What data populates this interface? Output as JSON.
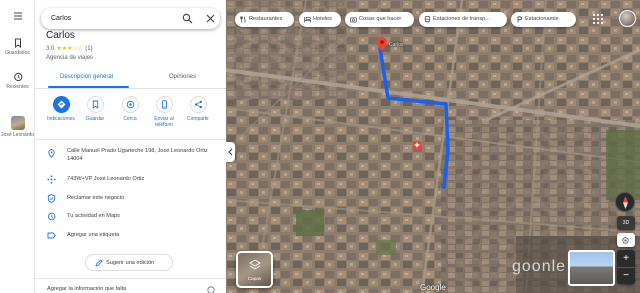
{
  "rail": {
    "saved_label": "Guardados",
    "recent_label": "Recientes",
    "recent_place_label": "José Leonardo"
  },
  "search": {
    "value": "Carlos"
  },
  "place": {
    "title": "Carlos",
    "rating": "3.0",
    "stars": "★★★☆☆",
    "review_count": "(1)",
    "category": "Agencia de viajes"
  },
  "tabs": [
    {
      "label": "Descripción general",
      "active": true
    },
    {
      "label": "Opiniones",
      "active": false
    }
  ],
  "actions": [
    {
      "label": "Indicaciones",
      "icon": "directions-icon"
    },
    {
      "label": "Guardar",
      "icon": "bookmark-icon"
    },
    {
      "label": "Cerca",
      "icon": "nearby-icon"
    },
    {
      "label": "Enviar al teléfono",
      "icon": "phone-icon"
    },
    {
      "label": "Compartir",
      "icon": "share-icon"
    }
  ],
  "info": {
    "address": "Calle Manuel Prado Ugarteche 198, José Leonardo Ortiz 14004",
    "plus_code": "743W+VP José Leonardo Ortiz",
    "claim": "Reclamar este negocio",
    "activity": "Tu actividad en Maps",
    "add_label": "Agregar una etiqueta"
  },
  "suggest_edit": "Sugerir una edición",
  "bottom_text": "Agregar la información que falta",
  "chips": [
    {
      "label": "Restaurantes",
      "icon": "restaurant-icon"
    },
    {
      "label": "Hoteles",
      "icon": "hotel-icon"
    },
    {
      "label": "Cosas que hacer",
      "icon": "camera-icon"
    },
    {
      "label": "Estaciones de transp...",
      "icon": "transit-icon"
    },
    {
      "label": "Estacionamie",
      "icon": "parking-icon"
    }
  ],
  "map": {
    "layers_label": "Capas",
    "tilt_label": "3D",
    "logo": "Google",
    "watermark": "goonle",
    "route_color": "#1a5ff0",
    "pin_color": "#ea4335",
    "accent": "#1a73e8"
  }
}
